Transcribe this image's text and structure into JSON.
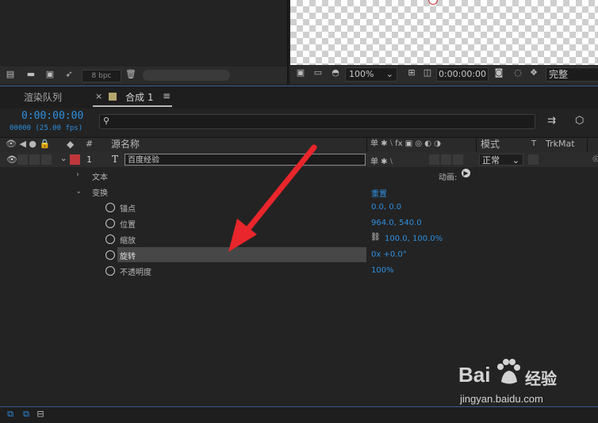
{
  "project": {
    "bpc": "8 bpc"
  },
  "viewer": {
    "zoom": "100%",
    "timecode": "0:00:00:00",
    "quality": "完整"
  },
  "tabs": {
    "render_queue": "渲染队列",
    "comp_close": "×",
    "comp": "合成 1",
    "comp_menu": "≡"
  },
  "timeline": {
    "timecode": "0:00:00:00",
    "frames": "00000 (25.00 fps)",
    "headers": {
      "num": "#",
      "source_name": "源名称",
      "switches": "单 ✱ ⧵ fx ▣ ◎ ◐ ◑",
      "mode": "模式",
      "t": "T",
      "trkmat": "TrkMat"
    }
  },
  "layer": {
    "number": "1",
    "type": "T",
    "name": "百度经验",
    "mode": "正常"
  },
  "groups": {
    "text": "文本",
    "transform": "变换",
    "animate": "动画:",
    "reset": "重置"
  },
  "properties": [
    {
      "name": "锚点",
      "value": "0.0, 0.0"
    },
    {
      "name": "位置",
      "value": "964.0, 540.0"
    },
    {
      "name": "缩放",
      "value": "100.0, 100.0%"
    },
    {
      "name": "旋转",
      "value": "0x +0.0°"
    },
    {
      "name": "不透明度",
      "value": "100%"
    }
  ],
  "watermark": {
    "brand_text": "Bai",
    "brand_text2": "经验",
    "url": "jingyan.baidu.com"
  },
  "colors": {
    "accent": "#2e8fe0",
    "layer_label": "#c0373b",
    "arrow": "#e8262b"
  }
}
